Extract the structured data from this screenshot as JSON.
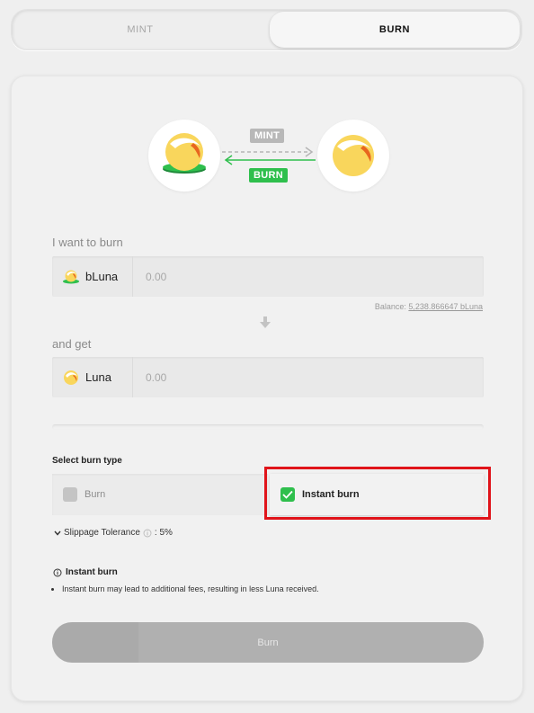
{
  "tabs": [
    {
      "label": "MINT",
      "active": false
    },
    {
      "label": "BURN",
      "active": true
    }
  ],
  "flow": {
    "mint_label": "MINT",
    "burn_label": "BURN",
    "mint_color": "#b8b8b8",
    "burn_color": "#2fbf4d"
  },
  "input": {
    "label": "I want to burn",
    "asset": "bLuna",
    "placeholder": "0.00",
    "balance_label": "Balance:",
    "balance_value": "5,238.866647 bLuna"
  },
  "output": {
    "label": "and get",
    "asset": "Luna",
    "placeholder": "0.00"
  },
  "burn_type": {
    "title": "Select burn type",
    "options": [
      {
        "label": "Burn",
        "selected": false
      },
      {
        "label": "Instant burn",
        "selected": true
      }
    ]
  },
  "slippage": {
    "label": "Slippage Tolerance",
    "value": ": 5%"
  },
  "info": {
    "title": "Instant burn",
    "items": [
      "Instant burn may lead to additional fees, resulting in less Luna received."
    ]
  },
  "submit": {
    "label": "Burn"
  },
  "colors": {
    "accent_green": "#2fbf4d",
    "highlight_red": "#e0141a",
    "luna_yellow": "#f9d65c",
    "luna_orange": "#e8661f"
  }
}
